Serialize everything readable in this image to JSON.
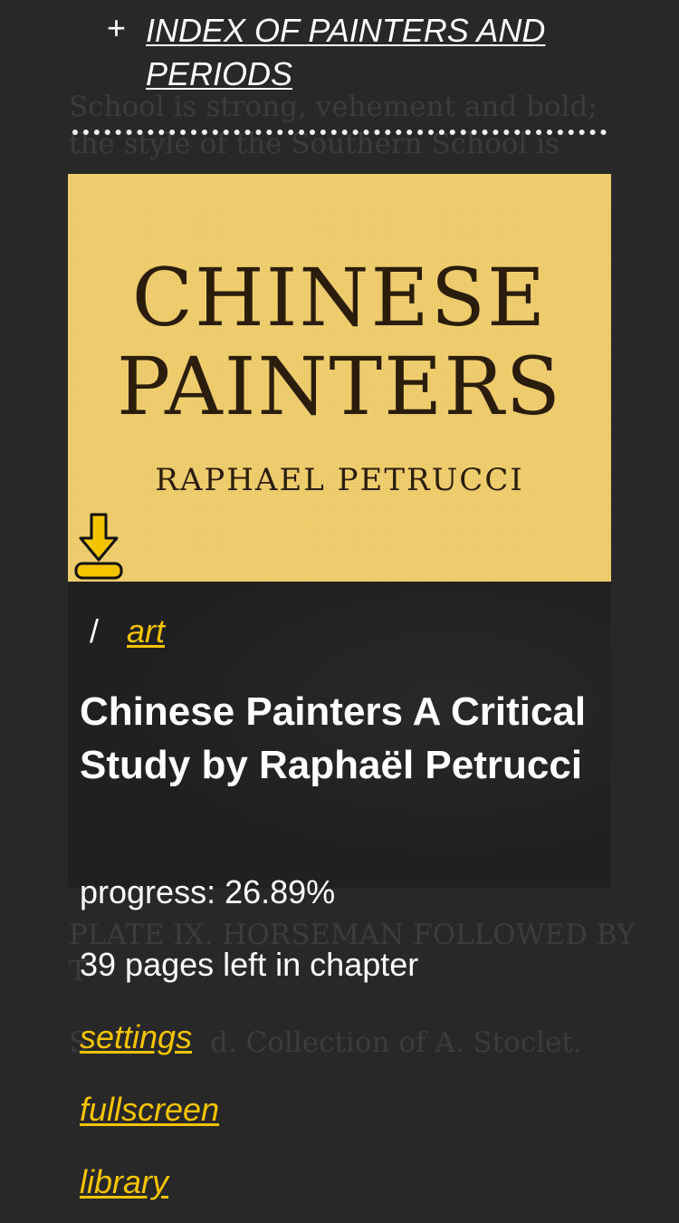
{
  "toc": {
    "expand_symbol": "+",
    "link_label": "INDEX OF PAINTERS AND PERIODS"
  },
  "background_text": {
    "line1": "School is strong, vehement and bold;",
    "line2": "the style of the Southern School is",
    "line3": "PLATE IX. HORSEMAN FOLLOWED BY",
    "line4": "T",
    "line5": "S",
    "line6": "d. Collection of A. Stoclet."
  },
  "cover": {
    "title_line1": "CHINESE",
    "title_line2": "PAINTERS",
    "author": "RAPHAEL PETRUCCI",
    "download_icon": "download-icon",
    "background_color": "#f1cf6e"
  },
  "breadcrumb": {
    "separator": "/",
    "category": "art"
  },
  "book": {
    "title": "Chinese Painters A Critical Study by Raphaël Petrucci",
    "progress_label": "progress: 26.89%",
    "progress_percent": 26.89,
    "pages_left_label": "39 pages left in chapter"
  },
  "menu": {
    "settings": "settings",
    "fullscreen": "fullscreen",
    "library": "library"
  },
  "colors": {
    "accent": "#f5c400",
    "background": "#282828",
    "panel": "#202020"
  }
}
